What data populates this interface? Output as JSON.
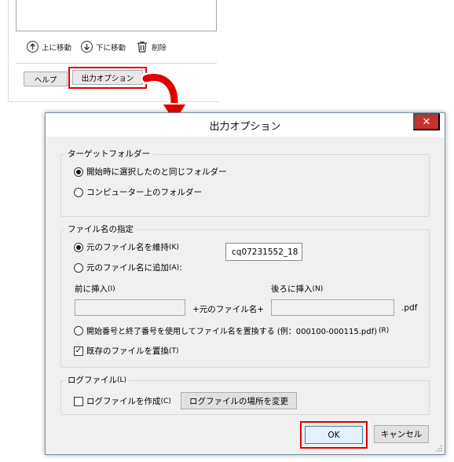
{
  "parent_window": {
    "toolbar": {
      "move_up_label": "上に移動",
      "move_down_label": "下に移動",
      "delete_label": "削除"
    },
    "help_button": "ヘルプ",
    "output_options_button": "出力オプション"
  },
  "highlight_color": "#e00000",
  "dialog": {
    "title": "出力オプション",
    "close_glyph": "✕",
    "target_folder": {
      "legend": "ターゲットフォルダー",
      "options": [
        {
          "label": "開始時に選択したのと同じフォルダー",
          "selected": true
        },
        {
          "label": "コンピューター上のフォルダー",
          "selected": false
        }
      ]
    },
    "file_naming": {
      "legend": "ファイル名の指定",
      "keep_original": {
        "label": "元のファイル名を維持",
        "shortcut": "(K)",
        "selected": true
      },
      "filename_preview": "cq07231552_18",
      "append_to_original": {
        "label": "元のファイル名に追加",
        "shortcut": "(A)",
        "suffix": " :",
        "selected": false
      },
      "insert_before_label": "前に挿入",
      "insert_before_shortcut": "(I)",
      "insert_before_value": "",
      "insert_after_label": "後ろに挿入",
      "insert_after_shortcut": "(N)",
      "insert_after_value": "",
      "plus_original_label": "+元のファイル名+",
      "extension_label": ".pdf",
      "replace_with_numbers": {
        "label": "開始番号と終了番号を使用してファイル名を置換する (例：000100-000115.pdf)",
        "shortcut": "(R)",
        "selected": false
      },
      "overwrite_existing": {
        "label": "既存のファイルを置換",
        "shortcut": "(T)",
        "checked": true
      }
    },
    "log_file": {
      "legend": "ログファイル",
      "legend_shortcut": "(L)",
      "create_log": {
        "label": "ログファイルを作成",
        "shortcut": "(C)",
        "checked": false
      },
      "change_location_button": "ログファイルの場所を変更"
    },
    "ok_button": "OK",
    "cancel_button": "キャンセル"
  }
}
